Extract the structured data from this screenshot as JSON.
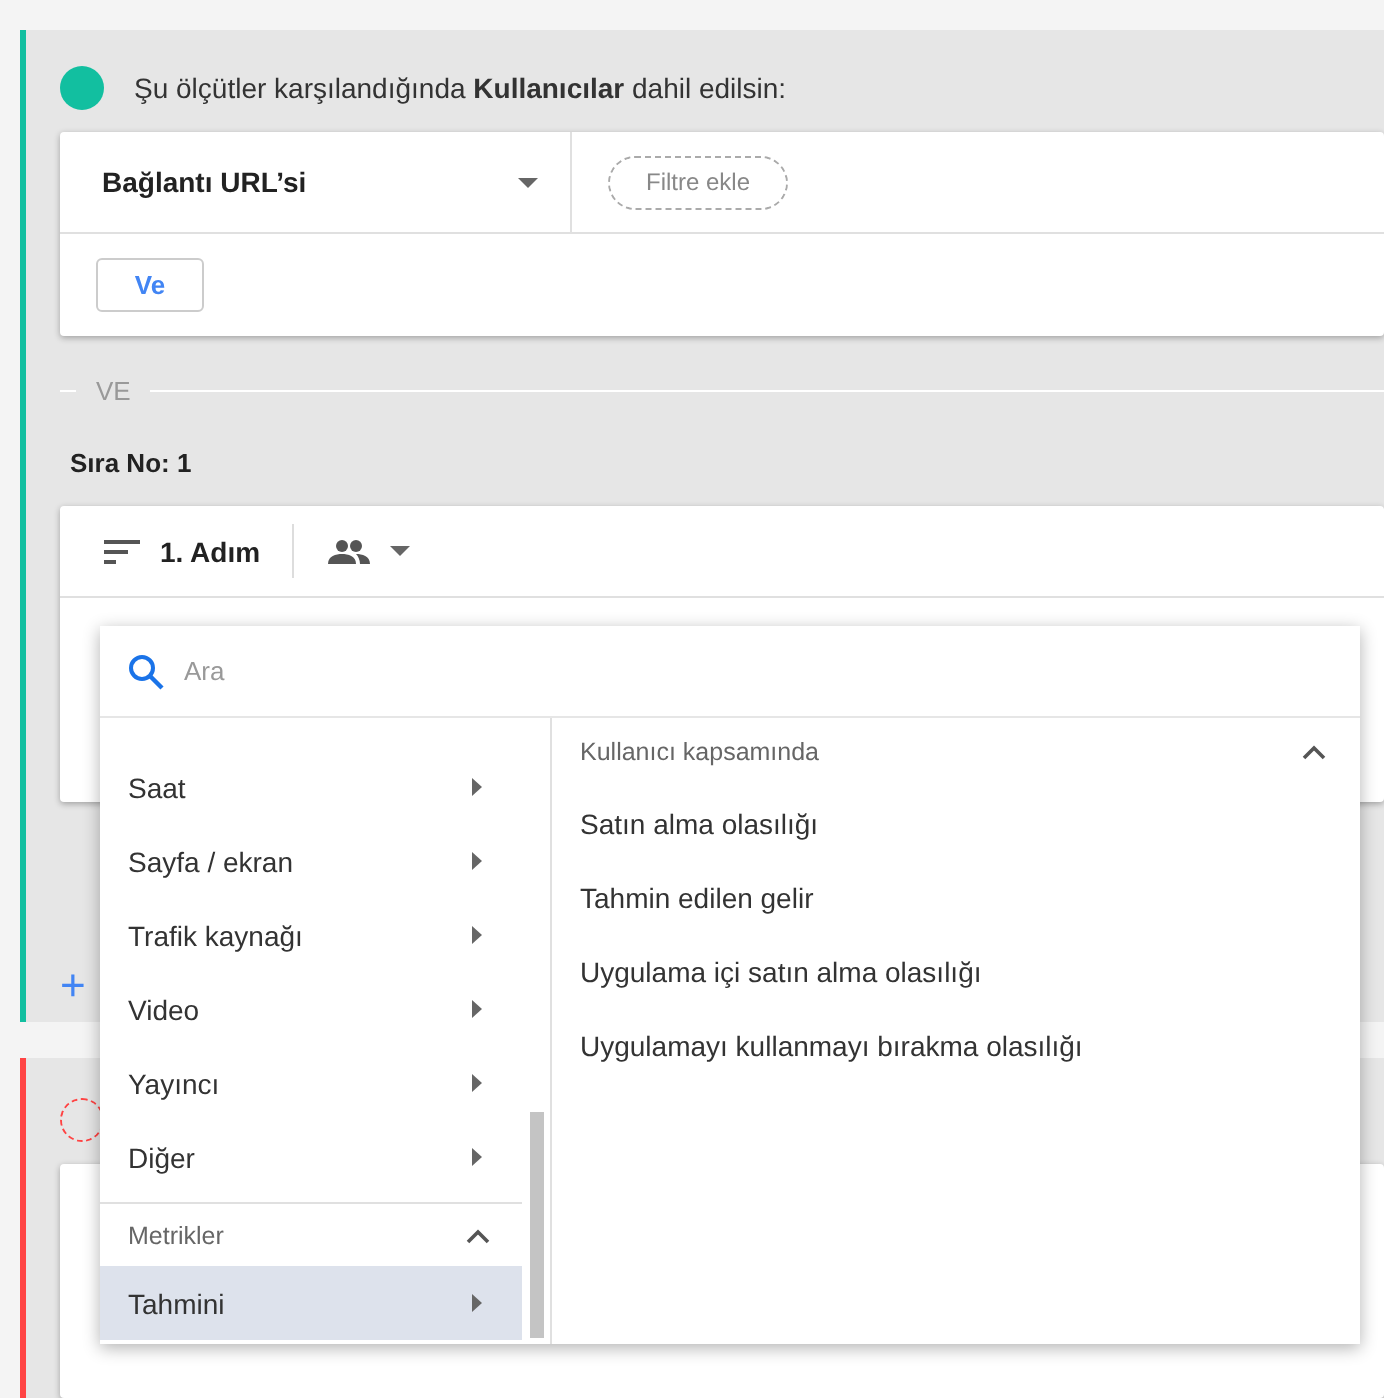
{
  "criteria": {
    "text": "Şu ölçütler karşılandığında **Kullanıcılar** dahil edilsin:",
    "dimension": "Bağlantı URL’si",
    "add_filter": "Filtre ekle",
    "and_button": "Ve"
  },
  "separator": "VE",
  "sequence": {
    "title": "Sıra No: 1",
    "step": "1. Adım"
  },
  "add_symbol": "+",
  "dropdown": {
    "search_placeholder": "Ara",
    "categories": [
      {
        "kind": "category",
        "label": "Saat",
        "selected": false
      },
      {
        "kind": "category",
        "label": "Sayfa / ekran",
        "selected": false
      },
      {
        "kind": "category",
        "label": "Trafik kaynağı",
        "selected": false
      },
      {
        "kind": "category",
        "label": "Video",
        "selected": false
      },
      {
        "kind": "category",
        "label": "Yayıncı",
        "selected": false
      },
      {
        "kind": "category",
        "label": "Diğer",
        "selected": false
      },
      {
        "kind": "header",
        "label": "Metrikler",
        "expanded": true
      },
      {
        "kind": "category",
        "label": "Tahmini",
        "selected": true
      }
    ],
    "submenu": {
      "header": {
        "label": "Kullanıcı kapsamında",
        "expanded": true
      },
      "items": [
        "Satın alma olasılığı",
        "Tahmin edilen gelir",
        "Uygulama içi satın alma olasılığı",
        "Uygulamayı kullanmayı bırakma olasılığı"
      ]
    }
  }
}
